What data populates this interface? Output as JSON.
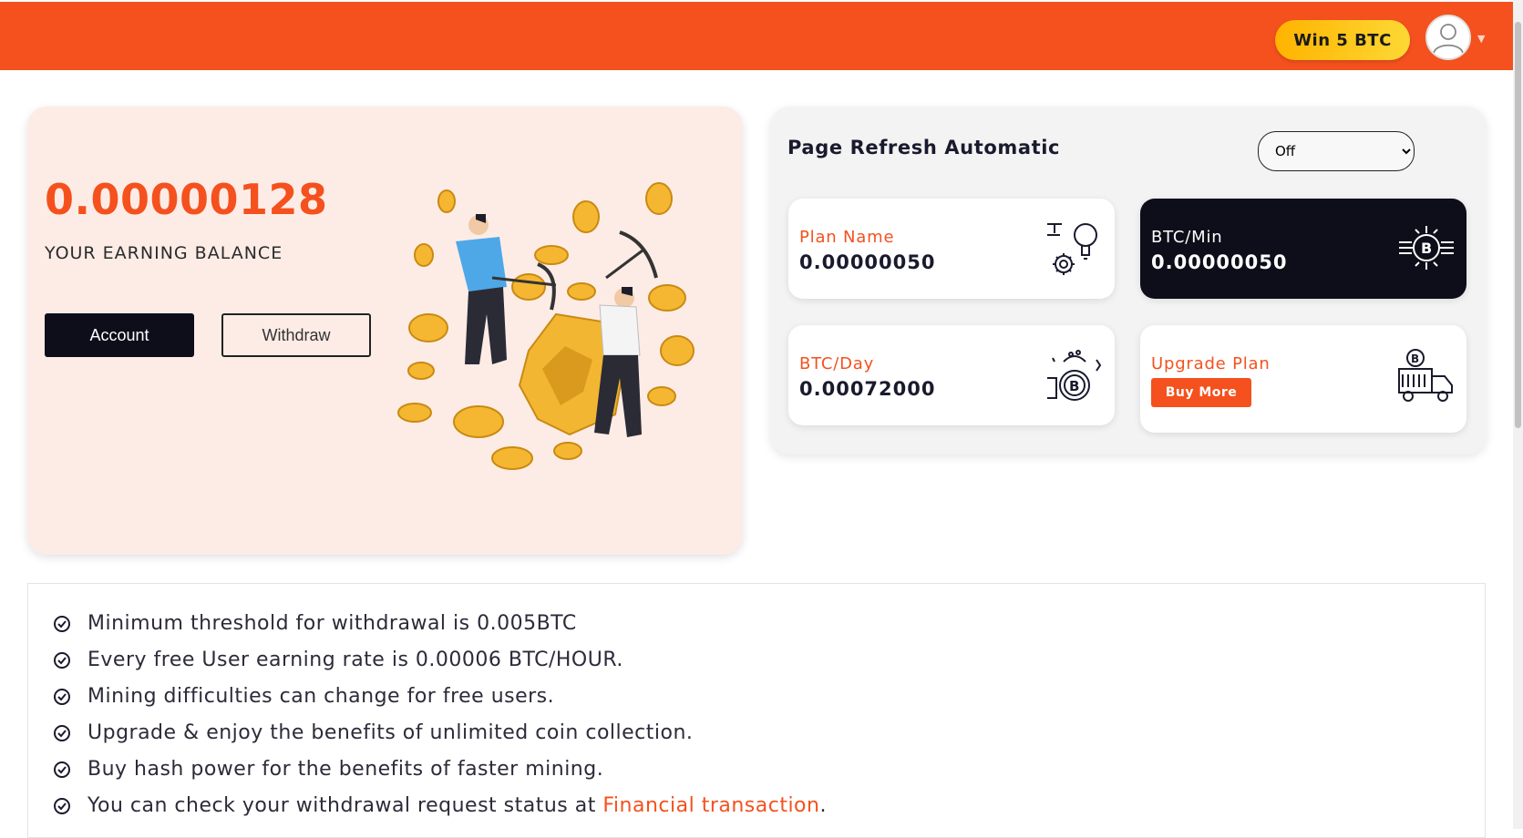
{
  "header": {
    "win_button": "Win 5 BTC",
    "brand_color": "#f4511e",
    "avatar_icon": "user-avatar-icon",
    "caret_icon": "caret-down-icon"
  },
  "balance": {
    "value": "0.00000128",
    "label": "YOUR EARNING BALANCE",
    "account_button": "Account",
    "withdraw_button": "Withdraw",
    "illustration": "bitcoin-mining-illustration"
  },
  "refresh": {
    "title": "Page Refresh Automatic",
    "selected": "Off",
    "options": [
      "Off"
    ]
  },
  "stats": [
    {
      "label": "Plan Name",
      "value": "0.00000050",
      "icon": "plan-gear-bulb-icon",
      "theme": "light"
    },
    {
      "label": "BTC/Min",
      "value": "0.00000050",
      "icon": "bitcoin-chip-icon",
      "theme": "dark"
    },
    {
      "label": "BTC/Day",
      "value": "0.00072000",
      "icon": "bitcoin-bag-icon",
      "theme": "light"
    },
    {
      "label": "Upgrade Plan",
      "button": "Buy More",
      "icon": "bitcoin-truck-icon",
      "theme": "light"
    }
  ],
  "info": {
    "items": [
      "Minimum threshold for withdrawal is 0.005BTC",
      "Every free User earning rate is 0.00006 BTC/HOUR.",
      "Mining difficulties can change for free users.",
      "Upgrade & enjoy the benefits of unlimited coin collection.",
      "Buy hash power for the benefits of faster mining.",
      "You can check your withdrawal request status at "
    ],
    "link_text": "Financial transaction",
    "link_suffix": ".",
    "check_icon": "check-circle-icon"
  }
}
